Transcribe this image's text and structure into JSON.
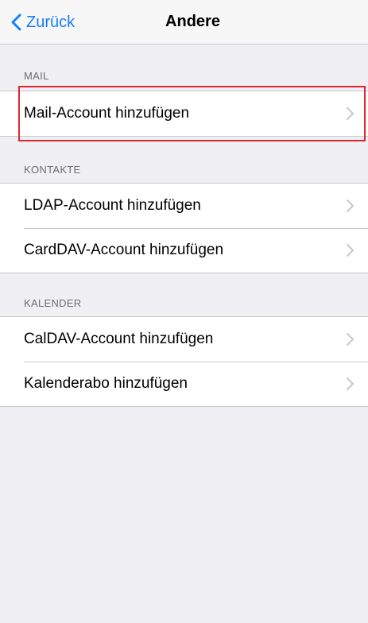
{
  "nav": {
    "back_label": "Zurück",
    "title": "Andere"
  },
  "sections": {
    "mail": {
      "header": "MAIL",
      "items": [
        {
          "label": "Mail-Account hinzufügen"
        }
      ]
    },
    "contacts": {
      "header": "KONTAKTE",
      "items": [
        {
          "label": "LDAP-Account hinzufügen"
        },
        {
          "label": "CardDAV-Account hinzufügen"
        }
      ]
    },
    "calendar": {
      "header": "KALENDER",
      "items": [
        {
          "label": "CalDAV-Account hinzufügen"
        },
        {
          "label": "Kalenderabo hinzufügen"
        }
      ]
    }
  },
  "colors": {
    "accent": "#157efb",
    "highlight": "#e0262e",
    "background": "#efeff4"
  }
}
